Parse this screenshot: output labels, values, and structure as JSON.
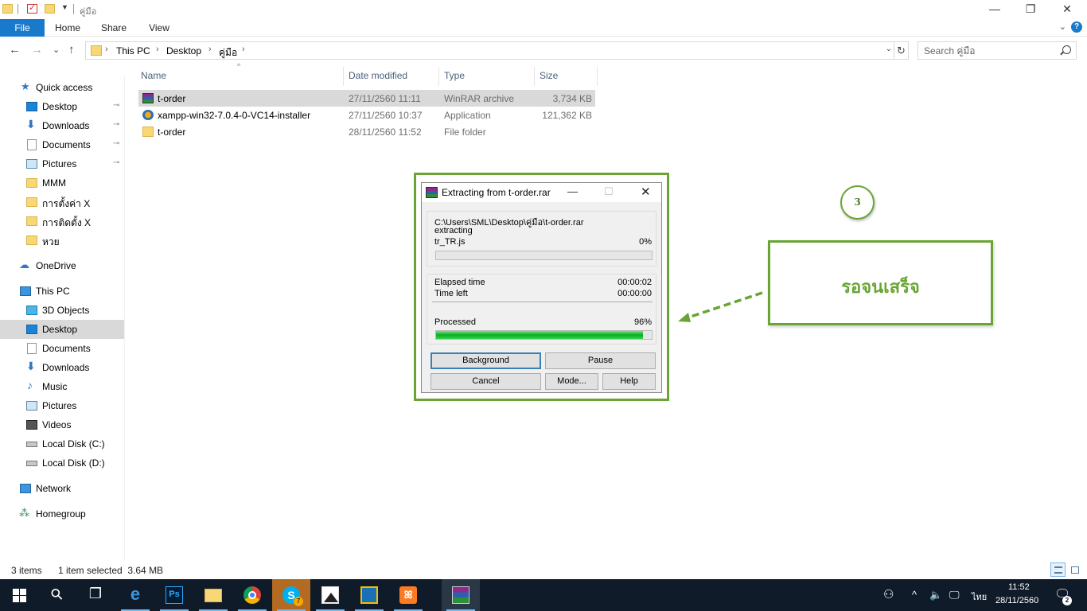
{
  "window": {
    "title": "คู่มือ",
    "controls": {
      "minimize": "—",
      "maximize": "❐",
      "close": "✕"
    }
  },
  "ribbon": {
    "tabs": [
      "File",
      "Home",
      "Share",
      "View"
    ],
    "expand_glyph": "⌄",
    "help_glyph": "?"
  },
  "nav_buttons": {
    "back": "←",
    "forward": "→",
    "recent": "⌄",
    "up": "↑"
  },
  "address": {
    "breadcrumbs": [
      "This PC",
      "Desktop",
      "คู่มือ"
    ],
    "separator": "›",
    "dropdown_glyph": "⌄",
    "refresh_glyph": "↻"
  },
  "search": {
    "placeholder": "Search คู่มือ"
  },
  "nav_pane": {
    "quick_access": "Quick access",
    "quick_items": [
      {
        "label": "Desktop",
        "icon": "desktop-icon",
        "pinned": true
      },
      {
        "label": "Downloads",
        "icon": "download-icon",
        "pinned": true
      },
      {
        "label": "Documents",
        "icon": "documents-icon",
        "pinned": true
      },
      {
        "label": "Pictures",
        "icon": "pictures-icon",
        "pinned": true
      },
      {
        "label": "MMM",
        "icon": "folder-icon",
        "pinned": false
      },
      {
        "label": "การตั้งค่า X",
        "icon": "folder-icon",
        "pinned": false
      },
      {
        "label": "การติดตั้ง X",
        "icon": "folder-icon",
        "pinned": false
      },
      {
        "label": "หวย",
        "icon": "folder-icon",
        "pinned": false
      }
    ],
    "pin_glyph": "📌",
    "onedrive": "OneDrive",
    "this_pc": "This PC",
    "pc_items": [
      {
        "label": "3D Objects",
        "icon": "3d-objects-icon"
      },
      {
        "label": "Desktop",
        "icon": "desktop-icon",
        "selected": true
      },
      {
        "label": "Documents",
        "icon": "documents-icon"
      },
      {
        "label": "Downloads",
        "icon": "download-icon"
      },
      {
        "label": "Music",
        "icon": "music-icon"
      },
      {
        "label": "Pictures",
        "icon": "pictures-icon"
      },
      {
        "label": "Videos",
        "icon": "videos-icon"
      },
      {
        "label": "Local Disk (C:)",
        "icon": "disk-icon"
      },
      {
        "label": "Local Disk (D:)",
        "icon": "disk-icon"
      }
    ],
    "network": "Network",
    "homegroup": "Homegroup"
  },
  "file_list": {
    "columns": [
      "Name",
      "Date modified",
      "Type",
      "Size"
    ],
    "sort_glyph": "^",
    "rows": [
      {
        "name": "t-order",
        "date": "27/11/2560 11:11",
        "type": "WinRAR archive",
        "size": "3,734 KB",
        "icon": "winrar-archive-icon",
        "selected": true
      },
      {
        "name": "xampp-win32-7.0.4-0-VC14-installer",
        "date": "27/11/2560 10:37",
        "type": "Application",
        "size": "121,362 KB",
        "icon": "xampp-installer-icon",
        "selected": false
      },
      {
        "name": "t-order",
        "date": "28/11/2560 11:52",
        "type": "File folder",
        "size": "",
        "icon": "folder-icon",
        "selected": false
      }
    ]
  },
  "dialog": {
    "title": "Extracting from t-order.rar",
    "controls": {
      "minimize": "—",
      "maximize": "☐",
      "close": "✕"
    },
    "archive_path": "C:\\Users\\SML\\Desktop\\คู่มือ\\t-order.rar",
    "action": "extracting",
    "current_file": "tr_TR.js",
    "file_percent": "0%",
    "file_progress": 0,
    "elapsed_label": "Elapsed time",
    "elapsed_value": "00:00:02",
    "left_label": "Time left",
    "left_value": "00:00:00",
    "processed_label": "Processed",
    "processed_percent": "96%",
    "processed_progress": 0.96,
    "buttons": {
      "background": "Background",
      "pause": "Pause",
      "cancel": "Cancel",
      "mode": "Mode...",
      "help": "Help"
    }
  },
  "annotation": {
    "step_number": "3",
    "callout_text": "รอจนเสร็จ",
    "color": "#6aa534"
  },
  "status_bar": {
    "items_count": "3 items",
    "selection": "1 item selected  3.64 MB"
  },
  "taskbar": {
    "apps": [
      {
        "name": "start-button"
      },
      {
        "name": "search-button",
        "glyph": "⚲"
      },
      {
        "name": "task-view-button",
        "glyph": "❐"
      },
      {
        "name": "edge-app",
        "glyph": "e"
      },
      {
        "name": "photoshop-app",
        "glyph": "Ps"
      },
      {
        "name": "file-explorer-app"
      },
      {
        "name": "chrome-app"
      },
      {
        "name": "skype-app",
        "glyph": "S",
        "badge": "7"
      },
      {
        "name": "photos-app"
      },
      {
        "name": "virtualbox-app"
      },
      {
        "name": "xampp-app",
        "glyph": "ꕤ"
      },
      {
        "name": "winrar-app"
      }
    ],
    "tray": {
      "people_glyph": "⚇",
      "chevron_glyph": "^",
      "volume_glyph": "🔈",
      "network_glyph": "🖵",
      "language": "ไทย",
      "time": "11:52",
      "date": "28/11/2560",
      "notification_glyph": "🗨",
      "notification_count": "2"
    }
  }
}
